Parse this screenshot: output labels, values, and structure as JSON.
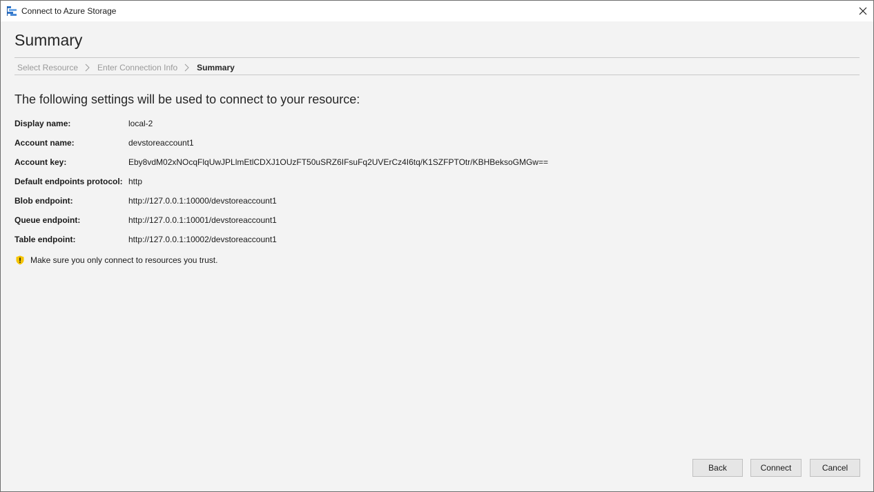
{
  "window": {
    "title": "Connect to Azure Storage"
  },
  "page": {
    "heading": "Summary",
    "intro": "The following settings will be used to connect to your resource:"
  },
  "breadcrumb": [
    {
      "label": "Select Resource",
      "current": false
    },
    {
      "label": "Enter Connection Info",
      "current": false
    },
    {
      "label": "Summary",
      "current": true
    }
  ],
  "settings": [
    {
      "label": "Display name:",
      "value": "local-2"
    },
    {
      "label": "Account name:",
      "value": "devstoreaccount1"
    },
    {
      "label": "Account key:",
      "value": "Eby8vdM02xNOcqFlqUwJPLlmEtlCDXJ1OUzFT50uSRZ6IFsuFq2UVErCz4I6tq/K1SZFPTOtr/KBHBeksoGMGw=="
    },
    {
      "label": "Default endpoints protocol:",
      "value": "http"
    },
    {
      "label": "Blob endpoint:",
      "value": "http://127.0.0.1:10000/devstoreaccount1"
    },
    {
      "label": "Queue endpoint:",
      "value": "http://127.0.0.1:10001/devstoreaccount1"
    },
    {
      "label": "Table endpoint:",
      "value": "http://127.0.0.1:10002/devstoreaccount1"
    }
  ],
  "warning": {
    "icon": "warning-shield-icon",
    "text": "Make sure you only connect to resources you trust."
  },
  "buttons": {
    "back": "Back",
    "connect": "Connect",
    "cancel": "Cancel"
  },
  "colors": {
    "window_bg": "#f3f3f3",
    "titlebar_bg": "#ffffff",
    "warning_yellow": "#f5c400",
    "button_bg": "#e6e6e6",
    "muted_text": "#9a9a9a"
  }
}
